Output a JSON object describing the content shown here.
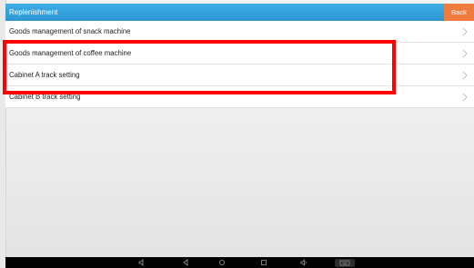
{
  "header": {
    "title": "Replenishment",
    "back_label": "Back"
  },
  "menu": {
    "items": [
      {
        "label": "Goods management of snack machine"
      },
      {
        "label": "Goods management of coffee machine"
      },
      {
        "label": "Cabinet A track setting"
      },
      {
        "label": "Cabinet B track setting"
      }
    ]
  },
  "colors": {
    "header": "#3399d6",
    "back_button": "#ef7b3d",
    "highlight": "#ff0000"
  },
  "icons": [
    "chevron-right-icon",
    "volume-down-icon",
    "back-icon",
    "home-icon",
    "recents-icon",
    "volume-up-icon",
    "keyboard-icon"
  ]
}
